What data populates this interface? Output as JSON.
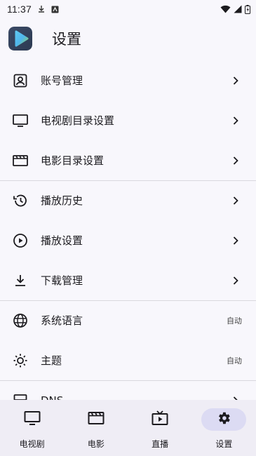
{
  "status_bar": {
    "time": "11:37",
    "icons": [
      "download-icon",
      "app-notification-icon",
      "wifi-icon",
      "signal-icon",
      "battery-icon"
    ]
  },
  "header": {
    "title": "设置",
    "logo_icon": "play-logo-icon"
  },
  "settings": {
    "items": [
      {
        "label": "账号管理",
        "icon": "account-box-icon",
        "trailing": ""
      },
      {
        "label": "电视剧目录设置",
        "icon": "tv-icon",
        "trailing": ""
      },
      {
        "label": "电影目录设置",
        "icon": "movie-icon",
        "trailing": ""
      },
      {
        "label": "播放历史",
        "icon": "history-icon",
        "trailing": ""
      },
      {
        "label": "播放设置",
        "icon": "play-circle-icon",
        "trailing": ""
      },
      {
        "label": "下载管理",
        "icon": "download-icon",
        "trailing": ""
      },
      {
        "label": "系统语言",
        "icon": "globe-icon",
        "trailing": "自动"
      },
      {
        "label": "主题",
        "icon": "brightness-icon",
        "trailing": "自动"
      },
      {
        "label": "DNS",
        "icon": "dns-icon",
        "trailing": ""
      }
    ]
  },
  "bottom_nav": {
    "items": [
      {
        "label": "电视剧",
        "icon": "tv-icon"
      },
      {
        "label": "电影",
        "icon": "movie-icon"
      },
      {
        "label": "直播",
        "icon": "live-tv-icon"
      },
      {
        "label": "设置",
        "icon": "gear-icon"
      }
    ],
    "active": "设置"
  },
  "colors": {
    "background": "#f8f7fc",
    "nav_background": "#efedf5",
    "active_indicator": "#dcdbf3",
    "divider": "#d9d8de"
  }
}
